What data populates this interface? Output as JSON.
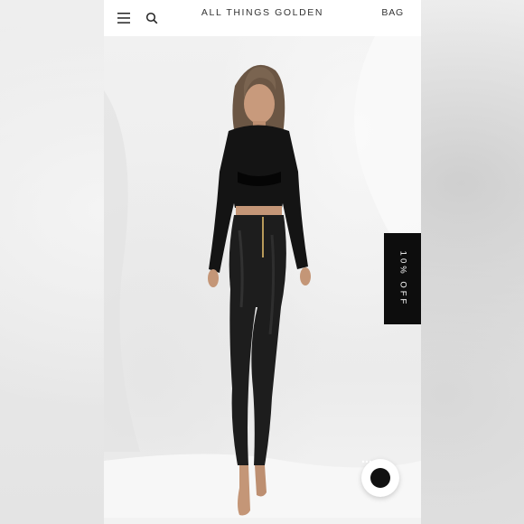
{
  "header": {
    "brand": "ALL THINGS GOLDEN",
    "bag_label": "BAG",
    "menu_icon": "hamburger-menu-icon",
    "search_icon": "search-icon"
  },
  "hero": {
    "image": "model-photo-black-mesh-top-leather-leggings"
  },
  "promo": {
    "label": "10% OFF"
  },
  "chat": {
    "icon": "chat-bubble-icon"
  },
  "colors": {
    "header_bg": "#ffffff",
    "promo_bg": "#0d0d0d",
    "text": "#333333"
  }
}
